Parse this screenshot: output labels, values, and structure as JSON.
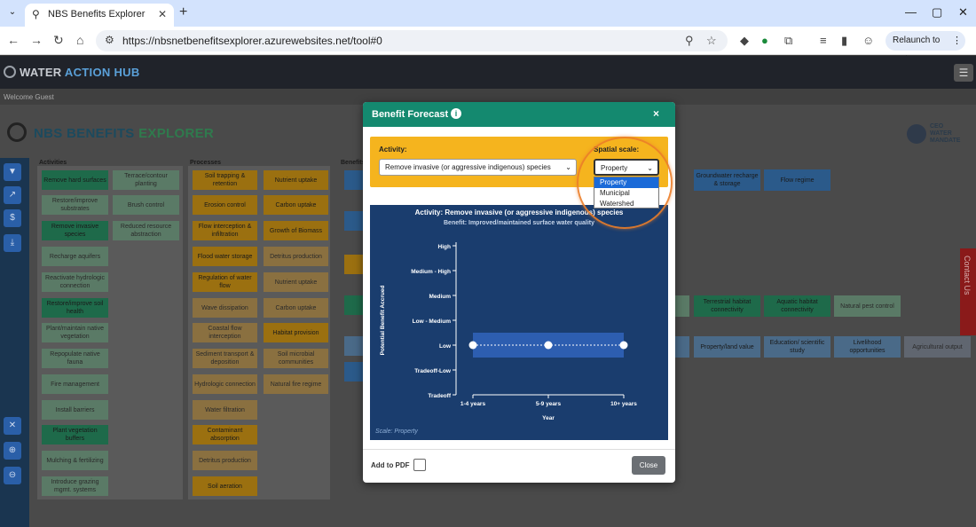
{
  "browser": {
    "tab_title": "NBS Benefits Explorer",
    "url": "https://nbsnetbenefitsexplorer.azurewebsites.net/tool#0",
    "relaunch_label": "Relaunch to update"
  },
  "app": {
    "logo_word1": "WATER",
    "logo_word2": "ACTION HUB",
    "welcome": "Welcome Guest",
    "title_word1": "NBS BENEFITS",
    "title_word2": "EXPLORER",
    "ceo_logo_lines": [
      "CEO",
      "WATER",
      "MANDATE"
    ],
    "contact": "Contact Us"
  },
  "columns": {
    "activities_label": "Activities",
    "processes_label": "Processes",
    "benefits_label": "Benefits"
  },
  "activities": [
    "Remove hard surfaces",
    "Terrace/contour planting",
    "Restore/improve substrates",
    "Brush control",
    "Remove invasive species",
    "Reduced resource abstraction",
    "Recharge aquifers",
    "Reactivate hydrologic connection",
    "Restore/improve soil health",
    "Plant/maintain native vegetation",
    "Repopulate native fauna",
    "Fire management",
    "Install barriers",
    "Plant vegetation buffers",
    "Mulching & fertilizing",
    "Introduce grazing mgmt. systems"
  ],
  "processes": [
    "Soil trapping & retention",
    "Nutrient uptake",
    "Erosion control",
    "Carbon uptake",
    "Flow interception & infiltration",
    "Growth of Biomass",
    "Flood water storage",
    "Detritus production",
    "Regulation of water flow",
    "Nutrient uptake",
    "Wave dissipation",
    "Carbon uptake",
    "Coastal flow interception",
    "Habitat provision",
    "Sediment transport & deposition",
    "Soil microbial communities",
    "Hydrologic connection",
    "Natural fire regime",
    "Water filtration",
    "Contaminant absorption",
    "Detritus production",
    "Soil aeration"
  ],
  "benefits": [
    "Groundwater recharge & storage",
    "Flow regime",
    "Terrestrial habitat connectivity",
    "Aquatic habitat connectivity",
    "Natural pest control",
    "Property/land value",
    "Education/ scientific study",
    "Livelihood opportunities",
    "Agricultural output"
  ],
  "modal": {
    "title": "Benefit Forecast",
    "close_x": "×",
    "activity_label": "Activity:",
    "activity_value": "Remove invasive (or aggressive indigenous) species",
    "scale_label": "Spatial scale:",
    "scale_value": "Property",
    "scale_options": [
      "Property",
      "Municipal",
      "Watershed"
    ],
    "add_pdf_label": "Add to PDF",
    "close_button": "Close"
  },
  "chart_data": {
    "type": "line",
    "title": "Activity: Remove invasive (or aggressive indigenous) species",
    "subtitle": "Benefit: Improved/maintained surface water quality",
    "xlabel": "Year",
    "ylabel": "Potential Benefit Accrued",
    "categories": [
      "1-4 years",
      "5-9 years",
      "10+ years"
    ],
    "y_levels": [
      "Tradeoff",
      "Tradeoff-Low",
      "Low",
      "Low - Medium",
      "Medium",
      "Medium - High",
      "High"
    ],
    "values": [
      "Low",
      "Low",
      "Low"
    ],
    "band_level": "Low",
    "note": "Scale: Property",
    "colors": {
      "background": "#1a3d6e",
      "band": "#2d5eb0",
      "line": "#ffffff"
    }
  }
}
